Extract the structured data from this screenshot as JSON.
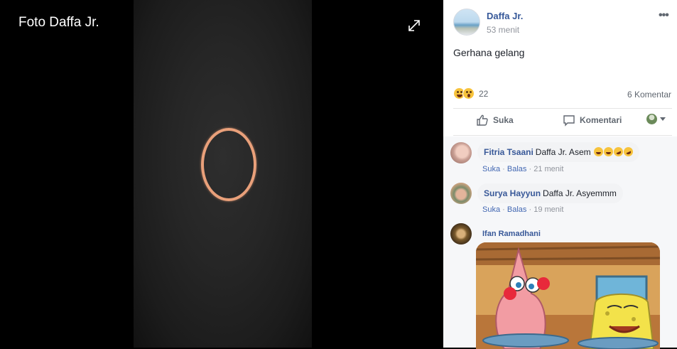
{
  "viewer": {
    "title": "Foto Daffa Jr."
  },
  "post": {
    "author": "Daffa Jr.",
    "time": "53 menit",
    "caption": "Gerhana gelang",
    "reaction_count": "22",
    "reactions": [
      "haha-icon",
      "wow-icon"
    ],
    "comment_count": "6 Komentar"
  },
  "actions": {
    "like": "Suka",
    "comment": "Komentari"
  },
  "comments": [
    {
      "name": "Fitria Tsaani",
      "text": "Daffa Jr. Asem",
      "like": "Suka",
      "reply": "Balas",
      "time": "21 menit"
    },
    {
      "name": "Surya Hayyun",
      "text": "Daffa Jr. Asyemmm",
      "like": "Suka",
      "reply": "Balas",
      "time": "19 menit"
    },
    {
      "name": "Ifan Ramadhani"
    }
  ],
  "meta_sep": "·",
  "colors": {
    "link": "#365899",
    "panel_bg": "#ffffff",
    "ring": "#e9a07a"
  }
}
